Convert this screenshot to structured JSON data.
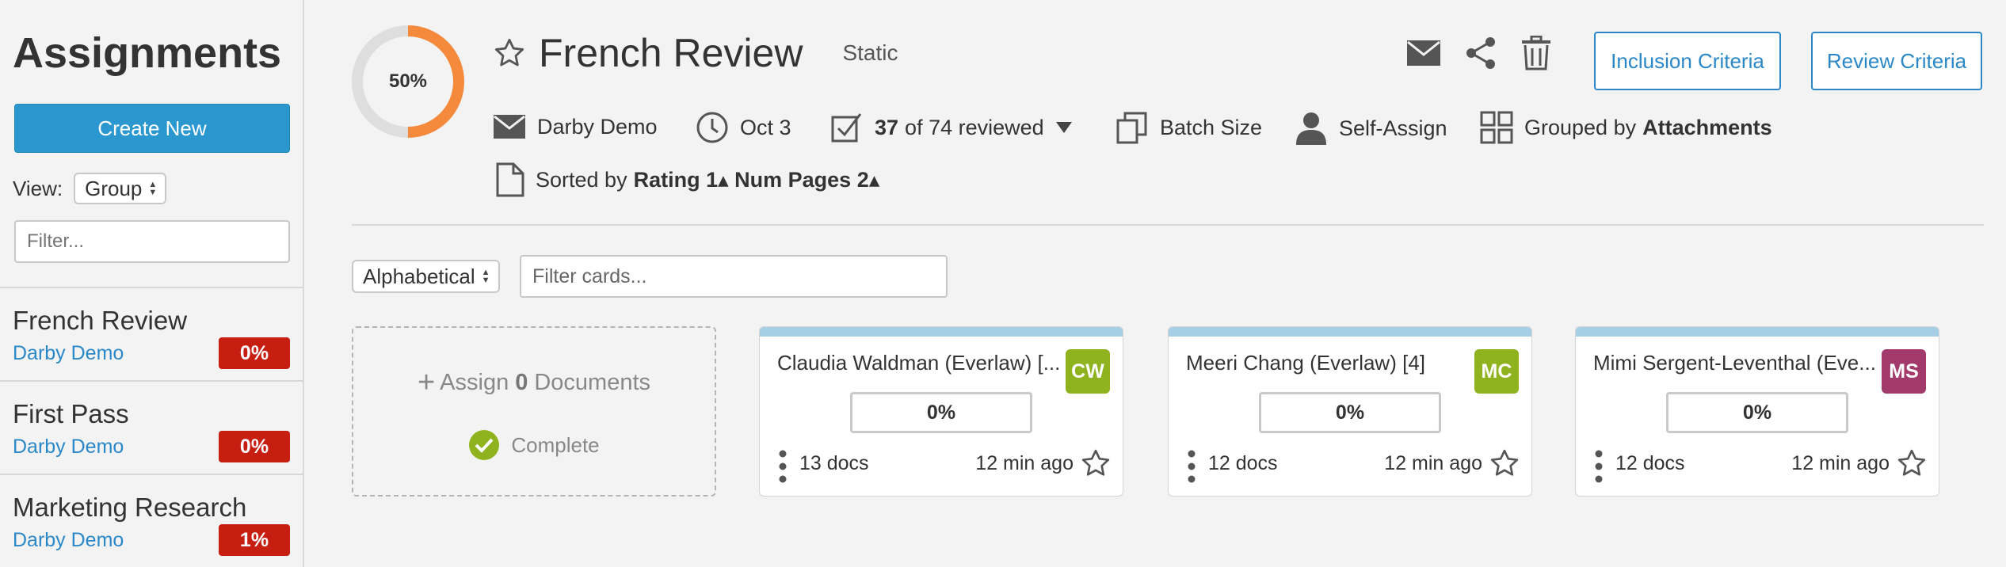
{
  "sidebar": {
    "title": "Assignments",
    "create_label": "Create New",
    "view_label": "View:",
    "view_value": "Group",
    "filter_placeholder": "Filter...",
    "items": [
      {
        "name": "French Review",
        "owner": "Darby Demo",
        "percent": "0%"
      },
      {
        "name": "First Pass",
        "owner": "Darby Demo",
        "percent": "0%"
      },
      {
        "name": "Marketing Research",
        "owner": "Darby Demo",
        "percent": "1%"
      }
    ]
  },
  "header": {
    "progress": "50%",
    "progress_fraction": 0.5,
    "title": "French Review",
    "type": "Static",
    "inclusion_label": "Inclusion Criteria",
    "review_label": "Review Criteria",
    "owner": "Darby Demo",
    "date": "Oct 3",
    "reviewed_count": "37",
    "reviewed_text": "of 74 reviewed",
    "batch_label": "Batch Size",
    "self_assign_label": "Self-Assign",
    "grouped_prefix": "Grouped by",
    "grouped_value": "Attachments",
    "sorted_prefix": "Sorted by",
    "sorted_value": "Rating 1▴ Num Pages 2▴"
  },
  "controls": {
    "sort_value": "Alphabetical",
    "filter_placeholder": "Filter cards..."
  },
  "assign_card": {
    "prefix": "Assign",
    "count": "0",
    "suffix": "Documents",
    "status": "Complete"
  },
  "cards": [
    {
      "name": "Claudia Waldman (Everlaw) [...",
      "initials": "CW",
      "avatar_color": "#8fb21f",
      "percent": "0%",
      "docs": "13 docs",
      "time": "12 min ago"
    },
    {
      "name": "Meeri Chang (Everlaw) [4]",
      "initials": "MC",
      "avatar_color": "#8fb21f",
      "percent": "0%",
      "docs": "12 docs",
      "time": "12 min ago"
    },
    {
      "name": "Mimi Sergent-Leventhal (Eve...",
      "initials": "MS",
      "avatar_color": "#a23a6b",
      "percent": "0%",
      "docs": "12 docs",
      "time": "12 min ago"
    }
  ],
  "colors": {
    "accent": "#2b97cf",
    "link": "#2b88c8",
    "badge_red": "#c71e12",
    "progress_orange": "#f58a3c",
    "card_bar": "#a6cfe6",
    "complete_green": "#8fb21f"
  }
}
